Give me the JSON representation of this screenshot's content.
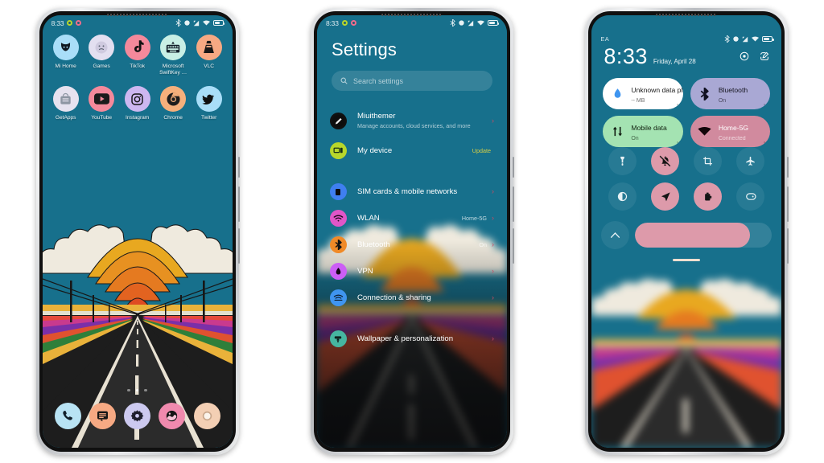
{
  "meta": {
    "accent_pink": "#dd9aaa",
    "wallpaper_sky": "#17708c",
    "chevron_color": "#c94b63",
    "update_badge_color": "#d9d045"
  },
  "phone1": {
    "name": "home-screen",
    "statusbar": {
      "time": "8:33",
      "icons": [
        "bluetooth-icon",
        "location-icon",
        "data-saver-icon",
        "wifi-icon",
        "battery-icon"
      ],
      "notification_dots": [
        "green",
        "pink"
      ]
    },
    "apps_row1": [
      {
        "label": "Mi Home",
        "icon": "mi-home-icon",
        "bg": "#a9def8",
        "fg": "#0f1720"
      },
      {
        "label": "Games",
        "icon": "games-icon",
        "bg": "#e3dff0",
        "fg": "#49505c"
      },
      {
        "label": "TikTok",
        "icon": "tiktok-icon",
        "bg": "#f4899b",
        "fg": "#111111"
      },
      {
        "label": "Microsoft SwiftKey …",
        "icon": "swiftkey-icon",
        "bg": "#c8efe5",
        "fg": "#14202b"
      },
      {
        "label": "VLC",
        "icon": "vlc-icon",
        "bg": "#f6a983",
        "fg": "#171717"
      }
    ],
    "apps_row2": [
      {
        "label": "GetApps",
        "icon": "getapps-icon",
        "bg": "#e6e2ef",
        "fg": "#7c8491"
      },
      {
        "label": "YouTube",
        "icon": "youtube-icon",
        "bg": "#f4899b",
        "fg": "#1b1b1b"
      },
      {
        "label": "Instagram",
        "icon": "instagram-icon",
        "bg": "#cdb7f0",
        "fg": "#161616"
      },
      {
        "label": "Chrome",
        "icon": "chrome-icon",
        "bg": "#f5b07c",
        "fg": "#1d1d1d"
      },
      {
        "label": "Twitter",
        "icon": "twitter-icon",
        "bg": "#a9def8",
        "fg": "#101010"
      }
    ],
    "page_dots": {
      "count": 3,
      "active_index": 1
    },
    "dock": [
      {
        "label": "Phone",
        "icon": "phone-icon",
        "bg": "#b8e3f4",
        "fg": "#12202b"
      },
      {
        "label": "Messages",
        "icon": "messages-icon",
        "bg": "#f6a983",
        "fg": "#161616"
      },
      {
        "label": "Settings",
        "icon": "settings-gear-icon",
        "bg": "#ccc9ef",
        "fg": "#1d1d2b"
      },
      {
        "label": "Gallery",
        "icon": "gallery-icon",
        "bg": "#f08aae",
        "fg": "#141414"
      },
      {
        "label": "Camera",
        "icon": "camera-icon",
        "bg": "#f3cfb4",
        "fg": "#fbf4ec"
      }
    ]
  },
  "phone2": {
    "name": "settings-screen",
    "statusbar": {
      "time": "8:33"
    },
    "title": "Settings",
    "search": {
      "placeholder": "Search settings",
      "icon": "search-icon"
    },
    "items": [
      {
        "label": "Miuithemer",
        "sub": "Manage accounts, cloud services, and more",
        "value": "",
        "badge": "",
        "icon": "account-avatar-icon",
        "bg": "#101010",
        "fg": "#ffffff",
        "chevron": "›"
      },
      {
        "label": "My device",
        "sub": "",
        "value": "",
        "badge": "Update",
        "icon": "device-icon",
        "bg": "#b7d72b",
        "fg": "#173017",
        "chevron": ""
      },
      {
        "label": "SIM cards & mobile networks",
        "sub": "",
        "value": "",
        "badge": "",
        "icon": "sim-card-icon",
        "bg": "#3f7ff0",
        "fg": "#0d0d0d",
        "chevron": "›"
      },
      {
        "label": "WLAN",
        "sub": "",
        "value": "Home-5G",
        "badge": "",
        "icon": "wifi-icon",
        "bg": "#e056c8",
        "fg": "#160616",
        "chevron": "›"
      },
      {
        "label": "Bluetooth",
        "sub": "",
        "value": "On",
        "badge": "",
        "icon": "bluetooth-icon",
        "bg": "#f08a27",
        "fg": "#141414",
        "chevron": "›"
      },
      {
        "label": "VPN",
        "sub": "",
        "value": "",
        "badge": "",
        "icon": "vpn-icon",
        "bg": "#cc5ef5",
        "fg": "#140614",
        "chevron": "›"
      },
      {
        "label": "Connection & sharing",
        "sub": "",
        "value": "",
        "badge": "",
        "icon": "connection-sharing-icon",
        "bg": "#3f95f0",
        "fg": "#0c1c2c",
        "chevron": "›"
      },
      {
        "label": "Wallpaper & personalization",
        "sub": "",
        "value": "",
        "badge": "",
        "icon": "wallpaper-brush-icon",
        "bg": "#46b5a0",
        "fg": "#0e211e",
        "chevron": "›"
      }
    ]
  },
  "phone3": {
    "name": "quick-settings-screen",
    "statusbar": {
      "carrier": "EA"
    },
    "clock": {
      "time": "8:33",
      "date": "Friday, April 28"
    },
    "header_actions": [
      {
        "name": "power-icon",
        "icon": "power-icon"
      },
      {
        "name": "edit-icon",
        "icon": "edit-icon"
      }
    ],
    "tiles": [
      {
        "title": "Unknown data plan",
        "sub": "-- MB",
        "icon": "data-usage-drop-icon",
        "bg": "#ffffff",
        "fg": "#1b1b1b",
        "icon_color": "#3f95f0"
      },
      {
        "title": "Bluetooth",
        "sub": "On",
        "icon": "bluetooth-icon",
        "bg": "#a9a8d4",
        "fg": "#14141e",
        "icon_color": "#101020"
      },
      {
        "title": "Mobile data",
        "sub": "On",
        "icon": "mobile-data-icon",
        "bg": "#a4e3b2",
        "fg": "#10200f",
        "icon_color": "#101a10"
      },
      {
        "title": "Home-5G",
        "sub": "Connected",
        "icon": "wifi-icon",
        "bg": "#d18a9e",
        "fg": "#ffffff",
        "icon_color": "#120509"
      }
    ],
    "toggles_row1": [
      {
        "name": "flashlight-toggle",
        "icon": "flashlight-icon",
        "on": false
      },
      {
        "name": "silent-toggle",
        "icon": "bell-off-icon",
        "on": true
      },
      {
        "name": "screenshot-toggle",
        "icon": "screenshot-icon",
        "on": false
      },
      {
        "name": "airplane-toggle",
        "icon": "airplane-icon",
        "on": false
      }
    ],
    "toggles_row2": [
      {
        "name": "dark-mode-toggle",
        "icon": "contrast-icon",
        "on": false
      },
      {
        "name": "location-toggle",
        "icon": "location-arrow-icon",
        "on": true
      },
      {
        "name": "battery-saver-toggle",
        "icon": "battery-saver-icon",
        "on": true
      },
      {
        "name": "cast-toggle",
        "icon": "cast-icon",
        "on": false
      }
    ],
    "brightness": {
      "value_percent": 84,
      "expand_icon": "chevron-up-icon"
    },
    "drag_handle": "panel-drag-handle"
  }
}
